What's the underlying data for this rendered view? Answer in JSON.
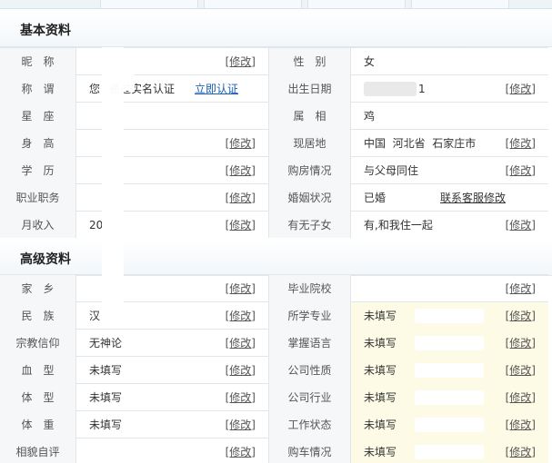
{
  "basic": {
    "title": "基本资料",
    "edit_label": "[修改]",
    "rows": [
      {
        "left_label": "昵　称",
        "left_value": "",
        "right_label": "性　别",
        "right_value": "女"
      },
      {
        "left_label": "称　谓",
        "left_value": "您",
        "left_status": "通过实名认证",
        "left_link": "立即认证",
        "right_label": "出生日期",
        "right_value": "1"
      },
      {
        "left_label": "星　座",
        "left_value": "",
        "right_label": "属　相",
        "right_value": "鸡"
      },
      {
        "left_label": "身　高",
        "left_value": "",
        "right_label": "现居地",
        "right_value": "中国  河北省  石家庄市"
      },
      {
        "left_label": "学　历",
        "left_value": "",
        "right_label": "购房情况",
        "right_value": "与父母同住"
      },
      {
        "left_label": "职业职务",
        "left_value": "",
        "right_label": "婚姻状况",
        "right_value": "已婚",
        "right_link": "联系客服修改"
      },
      {
        "left_label": "月收入",
        "left_value": "20",
        "right_label": "有无子女",
        "right_value": "有,和我住一起"
      }
    ]
  },
  "advanced": {
    "title": "高级资料",
    "edit_label": "[修改]",
    "rows": [
      {
        "left_label": "家　乡",
        "left_value": "",
        "right_label": "毕业院校",
        "right_value": ""
      },
      {
        "left_label": "民　族",
        "left_value": "汉",
        "right_label": "所学专业",
        "right_value": "未填写"
      },
      {
        "left_label": "宗教信仰",
        "left_value": "无神论",
        "right_label": "掌握语言",
        "right_value": "未填写"
      },
      {
        "left_label": "血　型",
        "left_value": "未填写",
        "right_label": "公司性质",
        "right_value": "未填写"
      },
      {
        "left_label": "体　型",
        "left_value": "未填写",
        "right_label": "公司行业",
        "right_value": "未填写"
      },
      {
        "left_label": "体　重",
        "left_value": "未填写",
        "right_label": "工作状态",
        "right_value": "未填写"
      },
      {
        "left_label": "相貌自评",
        "left_value": "",
        "right_label": "购车情况",
        "right_value": "未填写"
      }
    ]
  }
}
